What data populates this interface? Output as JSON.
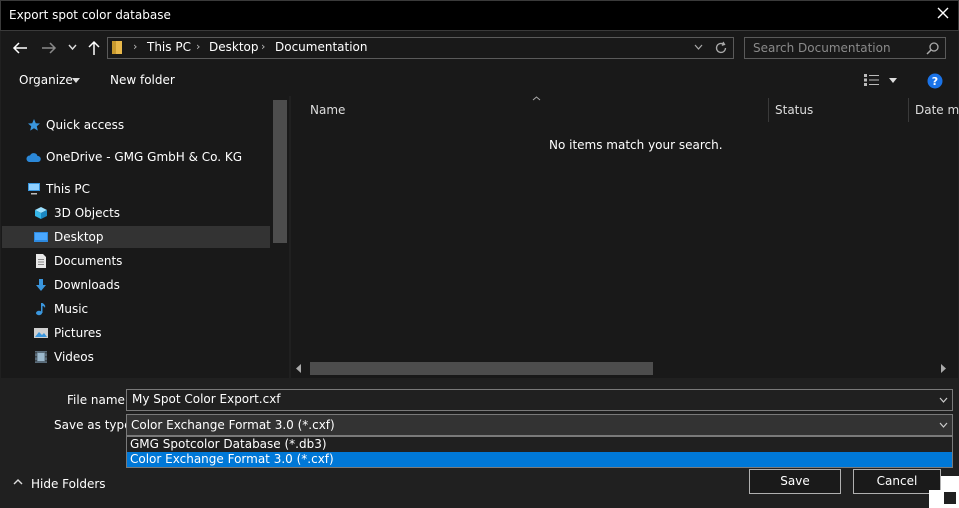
{
  "window": {
    "title": "Export spot color database"
  },
  "nav": {
    "path": [
      "This PC",
      "Desktop",
      "Documentation"
    ],
    "search_placeholder": "Search Documentation"
  },
  "toolbar": {
    "organize_label": "Organize",
    "new_folder_label": "New folder"
  },
  "sidebar": {
    "items": [
      {
        "label": "Quick access",
        "icon": "star-icon"
      },
      {
        "label": "OneDrive - GMG GmbH & Co. KG",
        "icon": "cloud-icon"
      },
      {
        "label": "This PC",
        "icon": "computer-icon"
      },
      {
        "label": "3D Objects",
        "icon": "cube-icon"
      },
      {
        "label": "Desktop",
        "icon": "desktop-icon",
        "selected": true
      },
      {
        "label": "Documents",
        "icon": "document-icon"
      },
      {
        "label": "Downloads",
        "icon": "download-arrow-icon"
      },
      {
        "label": "Music",
        "icon": "music-note-icon"
      },
      {
        "label": "Pictures",
        "icon": "picture-icon"
      },
      {
        "label": "Videos",
        "icon": "video-icon"
      }
    ]
  },
  "content": {
    "columns": [
      "Name",
      "Status",
      "Date mo"
    ],
    "empty_message": "No items match your search."
  },
  "form": {
    "file_name_label": "File name:",
    "file_name_value": "My Spot Color Export.cxf",
    "save_type_label": "Save as type:",
    "save_type_value": "Color Exchange Format 3.0 (*.cxf)",
    "options": [
      "GMG Spotcolor Database (*.db3)",
      "Color Exchange Format 3.0 (*.cxf)"
    ]
  },
  "footer": {
    "hide_folders_label": "Hide Folders",
    "save_label": "Save",
    "cancel_label": "Cancel"
  },
  "colors": {
    "accent": "#0078d7",
    "selected_item": "#333333"
  }
}
